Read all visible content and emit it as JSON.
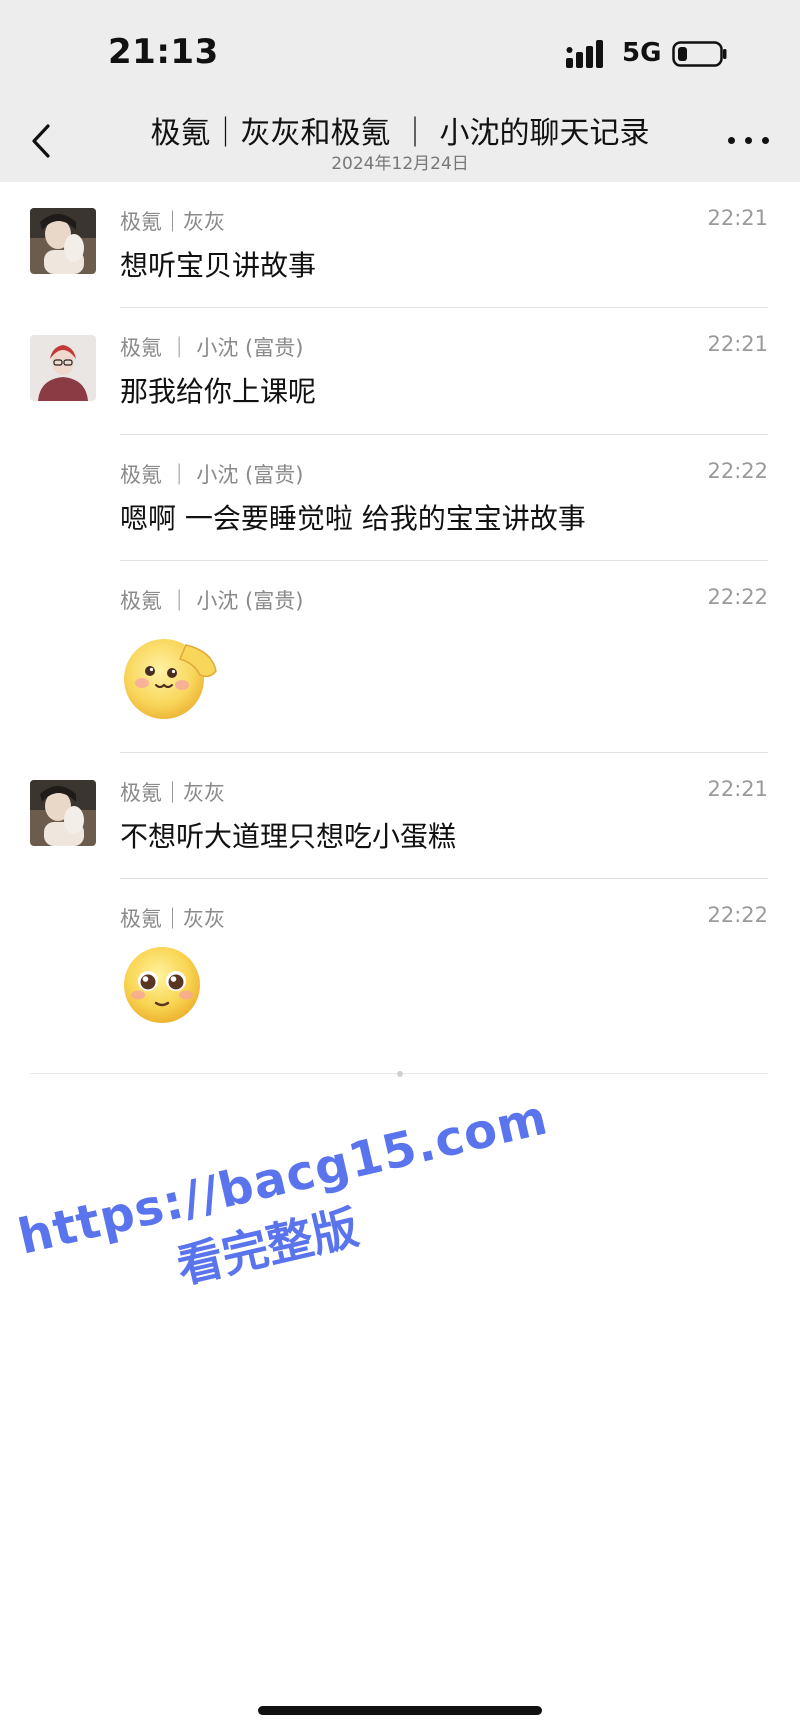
{
  "status": {
    "time": "21:13",
    "network": "5G"
  },
  "nav": {
    "title": "极氪｜灰灰和极氪 ｜ 小沈的聊天记录",
    "date": "2024年12月24日"
  },
  "messages": [
    {
      "sender": "极氪｜灰灰",
      "time": "22:21",
      "text": "想听宝贝讲故事"
    },
    {
      "sender": "极氪 ｜ 小沈 (富贵)",
      "time": "22:21",
      "text": "那我给你上课呢"
    },
    {
      "sender": "极氪 ｜ 小沈 (富贵)",
      "time": "22:22",
      "text": "嗯啊 一会要睡觉啦 给我的宝宝讲故事"
    },
    {
      "sender": "极氪 ｜ 小沈 (富贵)",
      "time": "22:22",
      "emoji": "salute-emoji"
    },
    {
      "sender": "极氪｜灰灰",
      "time": "22:21",
      "text": "不想听大道理只想吃小蛋糕"
    },
    {
      "sender": "极氪｜灰灰",
      "time": "22:22",
      "emoji": "pleading-emoji"
    }
  ],
  "watermark": {
    "url": "https://bacg15.com",
    "text": "看完整版"
  },
  "colors": {
    "watermark": "#5a74ee",
    "nav_bg": "#ededed"
  }
}
